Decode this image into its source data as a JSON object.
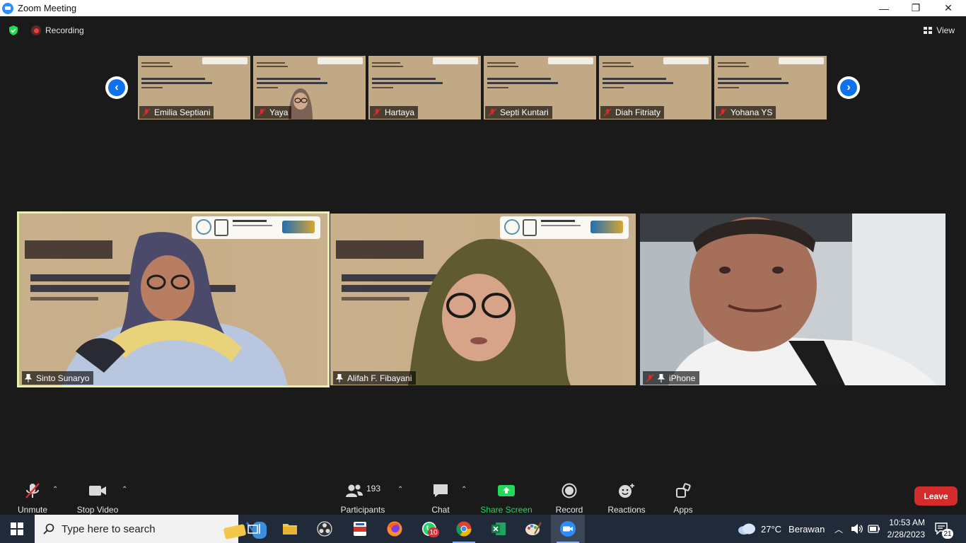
{
  "window": {
    "title": "Zoom Meeting",
    "minimize": "—",
    "restore": "❐",
    "close": "✕"
  },
  "topbar": {
    "recording_label": "Recording",
    "view_label": "View"
  },
  "thumbnails": [
    {
      "name": "Emilia Septiani",
      "muted": true
    },
    {
      "name": "Yaya",
      "muted": true
    },
    {
      "name": "Hartaya",
      "muted": true
    },
    {
      "name": "Septi Kuntari",
      "muted": true
    },
    {
      "name": "Diah Fitriaty",
      "muted": true
    },
    {
      "name": "Yohana YS",
      "muted": true
    }
  ],
  "gallery": [
    {
      "name": "Sinto Sunaryo",
      "active_speaker": true,
      "pinned": true
    },
    {
      "name": "Alifah F. Fibayani",
      "active_speaker": false,
      "pinned": true
    },
    {
      "name": "iPhone",
      "active_speaker": false,
      "pinned": true,
      "muted": true
    }
  ],
  "toolbar": {
    "unmute": "Unmute",
    "stop_video": "Stop Video",
    "participants": "Participants",
    "participants_count": "193",
    "chat": "Chat",
    "share_screen": "Share Screen",
    "record": "Record",
    "reactions": "Reactions",
    "apps": "Apps",
    "leave": "Leave"
  },
  "taskbar": {
    "search_placeholder": "Type here to search",
    "whatsapp_badge": "10",
    "weather_temp": "27°C",
    "weather_text": "Berawan",
    "time": "10:53 AM",
    "date": "2/28/2023",
    "notifications_count": "21"
  },
  "colors": {
    "share_green": "#23d959",
    "leave_red": "#d42b2b",
    "active_border": "#e9f0a4",
    "zoom_blue": "#2d8cff"
  }
}
